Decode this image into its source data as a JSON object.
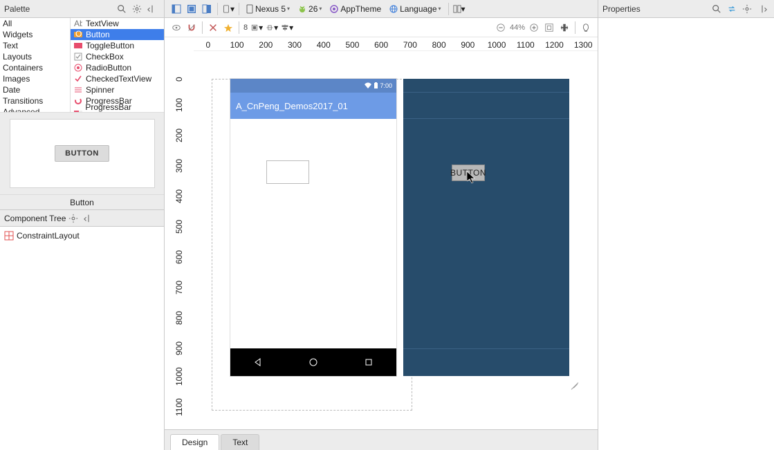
{
  "palette": {
    "title": "Palette",
    "categories": [
      "All",
      "Widgets",
      "Text",
      "Layouts",
      "Containers",
      "Images",
      "Date",
      "Transitions",
      "Advanced"
    ],
    "widgets": [
      {
        "label": "TextView"
      },
      {
        "label": "Button"
      },
      {
        "label": "ToggleButton"
      },
      {
        "label": "CheckBox"
      },
      {
        "label": "RadioButton"
      },
      {
        "label": "CheckedTextView"
      },
      {
        "label": "Spinner"
      },
      {
        "label": "ProgressBar"
      },
      {
        "label": "ProgressBar (Horizon"
      }
    ],
    "preview_button": "BUTTON",
    "preview_label": "Button"
  },
  "component_tree": {
    "title": "Component Tree",
    "root": "ConstraintLayout"
  },
  "center": {
    "device": "Nexus 5",
    "api": "26",
    "theme": "AppTheme",
    "lang": "Language",
    "margin_default": "8",
    "zoom_pct": "44%",
    "ruler_h": [
      "0",
      "100",
      "200",
      "300",
      "400",
      "500",
      "600",
      "700",
      "800",
      "900",
      "1000",
      "1100",
      "1200",
      "1300"
    ],
    "ruler_v": [
      "0",
      "100",
      "200",
      "300",
      "400",
      "500",
      "600",
      "700",
      "800",
      "900",
      "1000",
      "1100"
    ]
  },
  "phone": {
    "status_time": "7:00",
    "app_title": "A_CnPeng_Demos2017_01"
  },
  "blueprint": {
    "drag_label": "BUTTON"
  },
  "properties": {
    "title": "Properties"
  },
  "tabs": {
    "design": "Design",
    "text": "Text"
  }
}
